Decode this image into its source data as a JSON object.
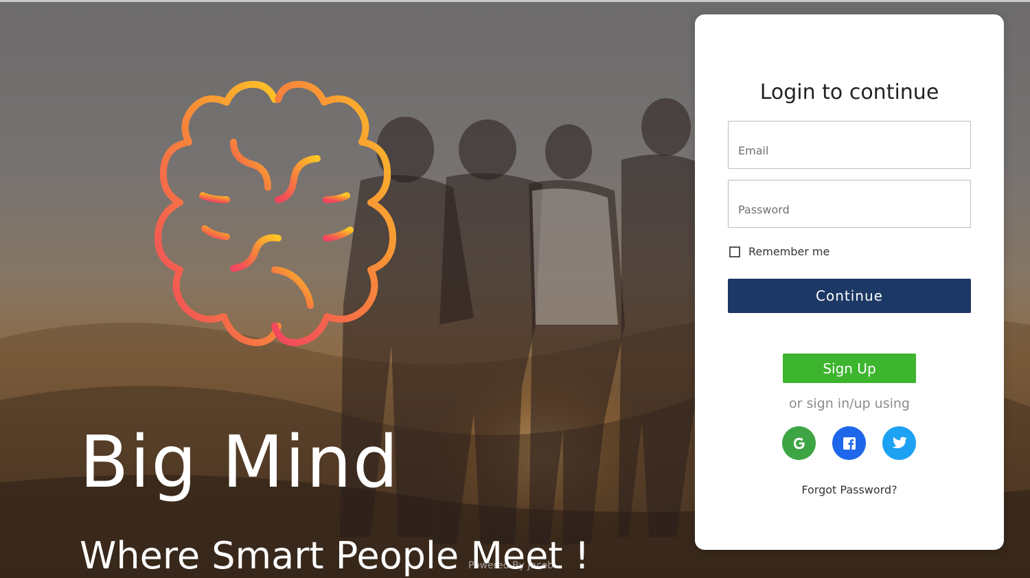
{
  "brand": {
    "title": "Big Mind",
    "tagline": "Where Smart People Meet !",
    "powered_by": "Powered By Jacob"
  },
  "login": {
    "title": "Login to continue",
    "email_placeholder": "Email",
    "password_placeholder": "Password",
    "remember_label": "Remember me",
    "remember_checked": false,
    "continue_label": "Continue",
    "signup_label": "Sign Up",
    "social_prompt": "or sign in/up using",
    "social": [
      {
        "name": "google",
        "icon": "google-icon",
        "color": "#3ea544"
      },
      {
        "name": "facebook",
        "icon": "facebook-icon",
        "color": "#1e67ea"
      },
      {
        "name": "twitter",
        "icon": "twitter-icon",
        "color": "#1da1f2"
      }
    ],
    "forgot_label": "Forgot Password?"
  },
  "colors": {
    "primary_button": "#1c3864",
    "signup_button": "#3db52e",
    "logo_gradient": [
      "#f2455e",
      "#f7a133",
      "#fdc526"
    ]
  }
}
